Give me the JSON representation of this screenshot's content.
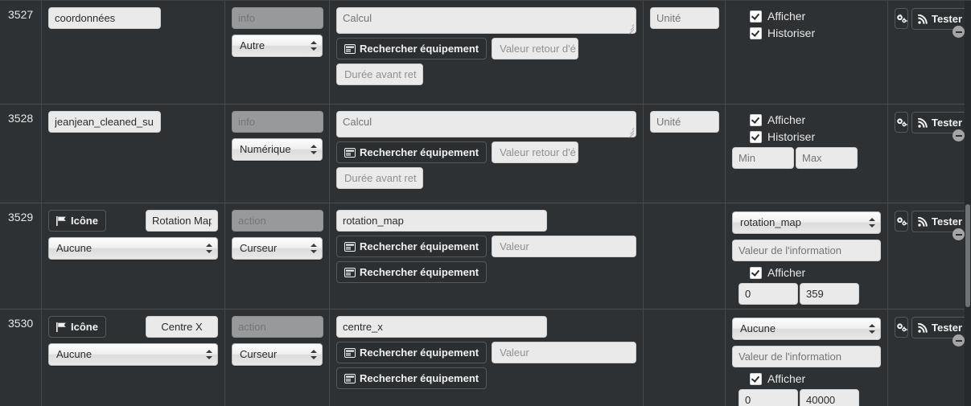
{
  "colors": {
    "page_bg": "#2d3134",
    "row_border": "#4a4f52",
    "input_bg": "#eaeaea",
    "disabled_bg": "#98999a",
    "accent_text": "#e8e8e8"
  },
  "labels": {
    "search_equipment": "Rechercher équipement",
    "icon_button": "Icône",
    "test_button": "Tester",
    "afficher": "Afficher",
    "historiser": "Historiser"
  },
  "placeholders": {
    "info": "info",
    "action": "action",
    "calcul": "Calcul",
    "unite": "Unité",
    "valeur_retour": "Valeur retour d'é",
    "duree_avant": "Durée avant ret",
    "valeur": "Valeur",
    "valeur_information": "Valeur de l'information",
    "min": "Min",
    "max": "Max"
  },
  "icons": {
    "cogs": "cogs-icon",
    "rss": "rss-icon",
    "flag": "flag-icon",
    "list_alt": "list-alt-icon",
    "minus_circle": "minus-circle-icon"
  },
  "rows": [
    {
      "id": "3527",
      "kind": "info",
      "name_value": "coordonnées",
      "type_placeholder": "info",
      "type_select": "Autre",
      "calc_placeholder": "Calcul",
      "search_label": "Rechercher équipement",
      "return_placeholder": "Valeur retour d'é",
      "duration_placeholder": "Durée avant ret",
      "unit_placeholder": "Unité",
      "afficher": "Afficher",
      "afficher_checked": true,
      "historiser": "Historiser",
      "historiser_checked": true,
      "show_minmax": false,
      "test_label": "Tester"
    },
    {
      "id": "3528",
      "kind": "info",
      "name_value": "jeanjean_cleaned_su",
      "type_placeholder": "info",
      "type_select": "Numérique",
      "calc_placeholder": "Calcul",
      "search_label": "Rechercher équipement",
      "return_placeholder": "Valeur retour d'é",
      "duration_placeholder": "Durée avant ret",
      "unit_placeholder": "Unité",
      "afficher": "Afficher",
      "afficher_checked": true,
      "historiser": "Historiser",
      "historiser_checked": true,
      "show_minmax": true,
      "min_placeholder": "Min",
      "max_placeholder": "Max",
      "test_label": "Tester"
    },
    {
      "id": "3529",
      "kind": "action",
      "icon_label": "Icône",
      "name_value": "Rotation Map",
      "none_select": "Aucune",
      "type_placeholder": "action",
      "type_select": "Curseur",
      "cmd_value": "rotation_map",
      "search_label": "Rechercher équipement",
      "value_placeholder": "Valeur",
      "search_label_2": "Rechercher équipement",
      "link_select": "rotation_map",
      "info_value_placeholder": "Valeur de l'information",
      "afficher": "Afficher",
      "afficher_checked": true,
      "min_value": "0",
      "max_value": "359",
      "test_label": "Tester"
    },
    {
      "id": "3530",
      "kind": "action",
      "icon_label": "Icône",
      "name_value": "Centre X",
      "none_select": "Aucune",
      "type_placeholder": "action",
      "type_select": "Curseur",
      "cmd_value": "centre_x",
      "search_label": "Rechercher équipement",
      "value_placeholder": "Valeur",
      "search_label_2": "Rechercher équipement",
      "link_select": "Aucune",
      "info_value_placeholder": "Valeur de l'information",
      "afficher": "Afficher",
      "afficher_checked": true,
      "min_value": "0",
      "max_value": "40000",
      "test_label": "Tester"
    }
  ]
}
